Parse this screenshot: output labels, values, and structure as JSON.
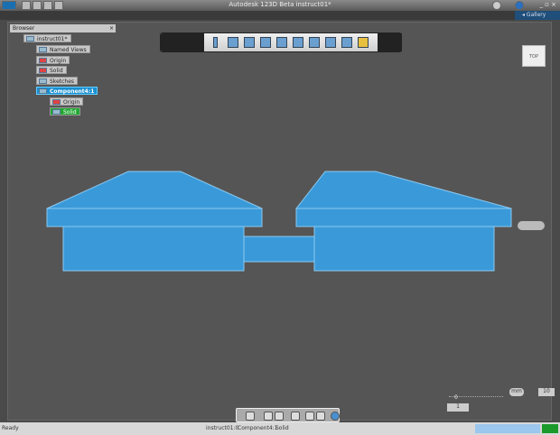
{
  "window": {
    "title": "Autodesk 123D Beta   instruct01*",
    "gallery_label": "Gallery"
  },
  "browser": {
    "header": "Browser",
    "root": "instruct01*",
    "items": [
      {
        "label": "Named Views"
      },
      {
        "label": "Origin"
      },
      {
        "label": "Solid"
      },
      {
        "label": "Sketches"
      },
      {
        "label": "Component4:1",
        "selected": true
      },
      {
        "label": "Origin"
      },
      {
        "label": "Solid",
        "highlighted": true
      }
    ]
  },
  "viewcube": {
    "face": "TOP"
  },
  "scale": {
    "unit": "mm",
    "max": "10",
    "min": "0",
    "value": "1"
  },
  "status": {
    "left": "Ready",
    "doc": "instruct01:0",
    "component": "Component4:1",
    "body": "Solid"
  },
  "colors": {
    "model": "#3a9ad9",
    "selection": "#1a8fd0",
    "solid_highlight": "#22a832"
  }
}
